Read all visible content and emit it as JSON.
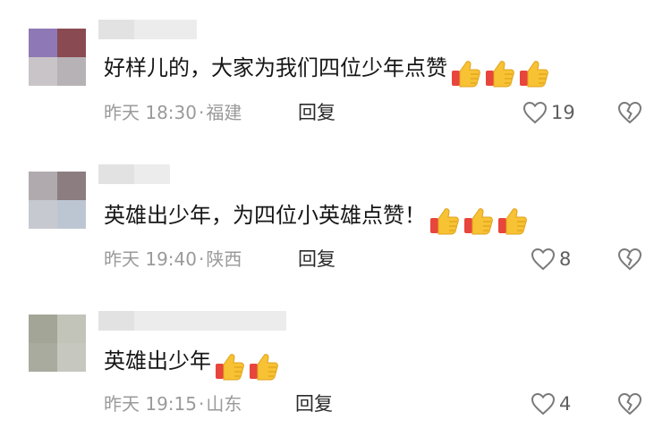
{
  "comments": [
    {
      "text": "好样儿的，大家为我们四位少年点赞",
      "emoji_count": 3,
      "time": "昨天 18:30",
      "location": "福建",
      "reply_label": "回复",
      "like_count": "19"
    },
    {
      "text": "英雄出少年，为四位小英雄点赞！",
      "emoji_count": 3,
      "time": "昨天 19:40",
      "location": "陕西",
      "reply_label": "回复",
      "like_count": "8"
    },
    {
      "text": "英雄出少年",
      "emoji_count": 2,
      "time": "昨天 19:15",
      "location": "山东",
      "reply_label": "回复",
      "like_count": "4"
    }
  ],
  "icons": {
    "thumbs_up_emoji": "thumbs-up-emoji",
    "like": "heart-outline-icon",
    "dislike": "broken-heart-icon"
  },
  "colors": {
    "text": "#161616",
    "meta": "#9a9a9a",
    "emoji_yellow": "#f7c233",
    "emoji_red": "#e8453c"
  }
}
